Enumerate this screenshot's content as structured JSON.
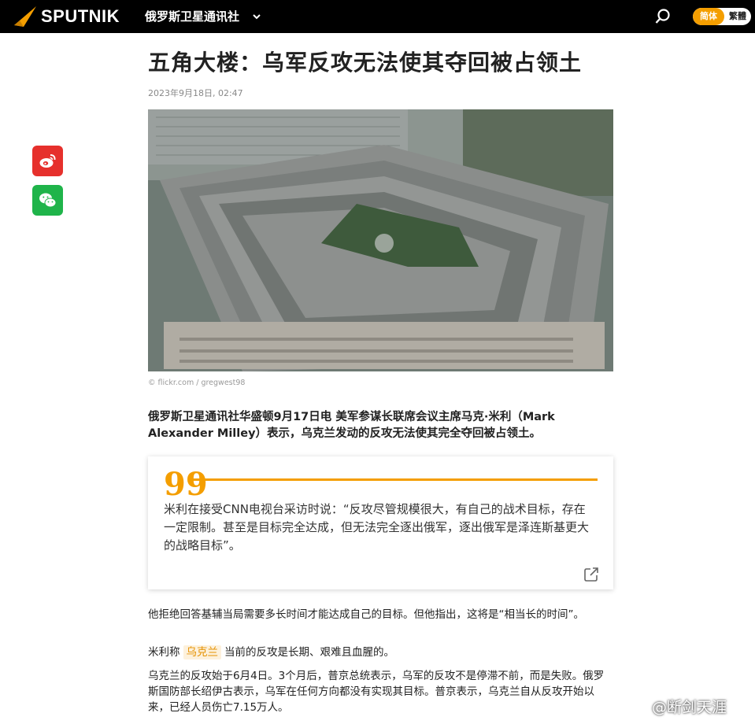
{
  "header": {
    "logo_text": "SPUTNIK",
    "site_name": "俄罗斯卫星通讯社",
    "lang_simplified": "简体",
    "lang_traditional": "繁體"
  },
  "article": {
    "title": "五角大楼：乌军反攻无法使其夺回被占领土",
    "date": "2023年9月18日, 02:47",
    "image_credit": "© flickr.com / gregwest98",
    "lead": "俄罗斯卫星通讯社华盛顿9月17日电 美军参谋长联席会议主席马克·米利（Mark Alexander Milley）表示，乌克兰发动的反攻无法使其完全夺回被占领土。",
    "quote": "米利在接受CNN电视台采访时说：“反攻尽管规模很大，有自己的战术目标，存在一定限制。甚至是目标完全达成，但无法完全逐出俄军，逐出俄军是泽连斯基更大的战略目标”。",
    "quote_mark": "99",
    "p1": "他拒绝回答基辅当局需要多长时间才能达成自己的目标。但他指出，这将是“相当长的时间”。",
    "p2_before": "米利称",
    "p2_tag": "乌克兰",
    "p2_after": "当前的反攻是长期、艰难且血腥的。",
    "p3": "乌克兰的反攻始于6月4日。3个月后，普京总统表示，乌军的反攻不是停滞不前，而是失败。俄罗斯国防部长绍伊古表示，乌军在任何方向都没有实现其目标。普京表示，乌克兰自从反攻开始以来，已经人员伤亡7.15万人。"
  },
  "watermark": "@断剑天涯",
  "colors": {
    "accent": "#f49e00",
    "weibo": "#e6302c",
    "wechat": "#1fb44a",
    "topbar": "#000000"
  }
}
